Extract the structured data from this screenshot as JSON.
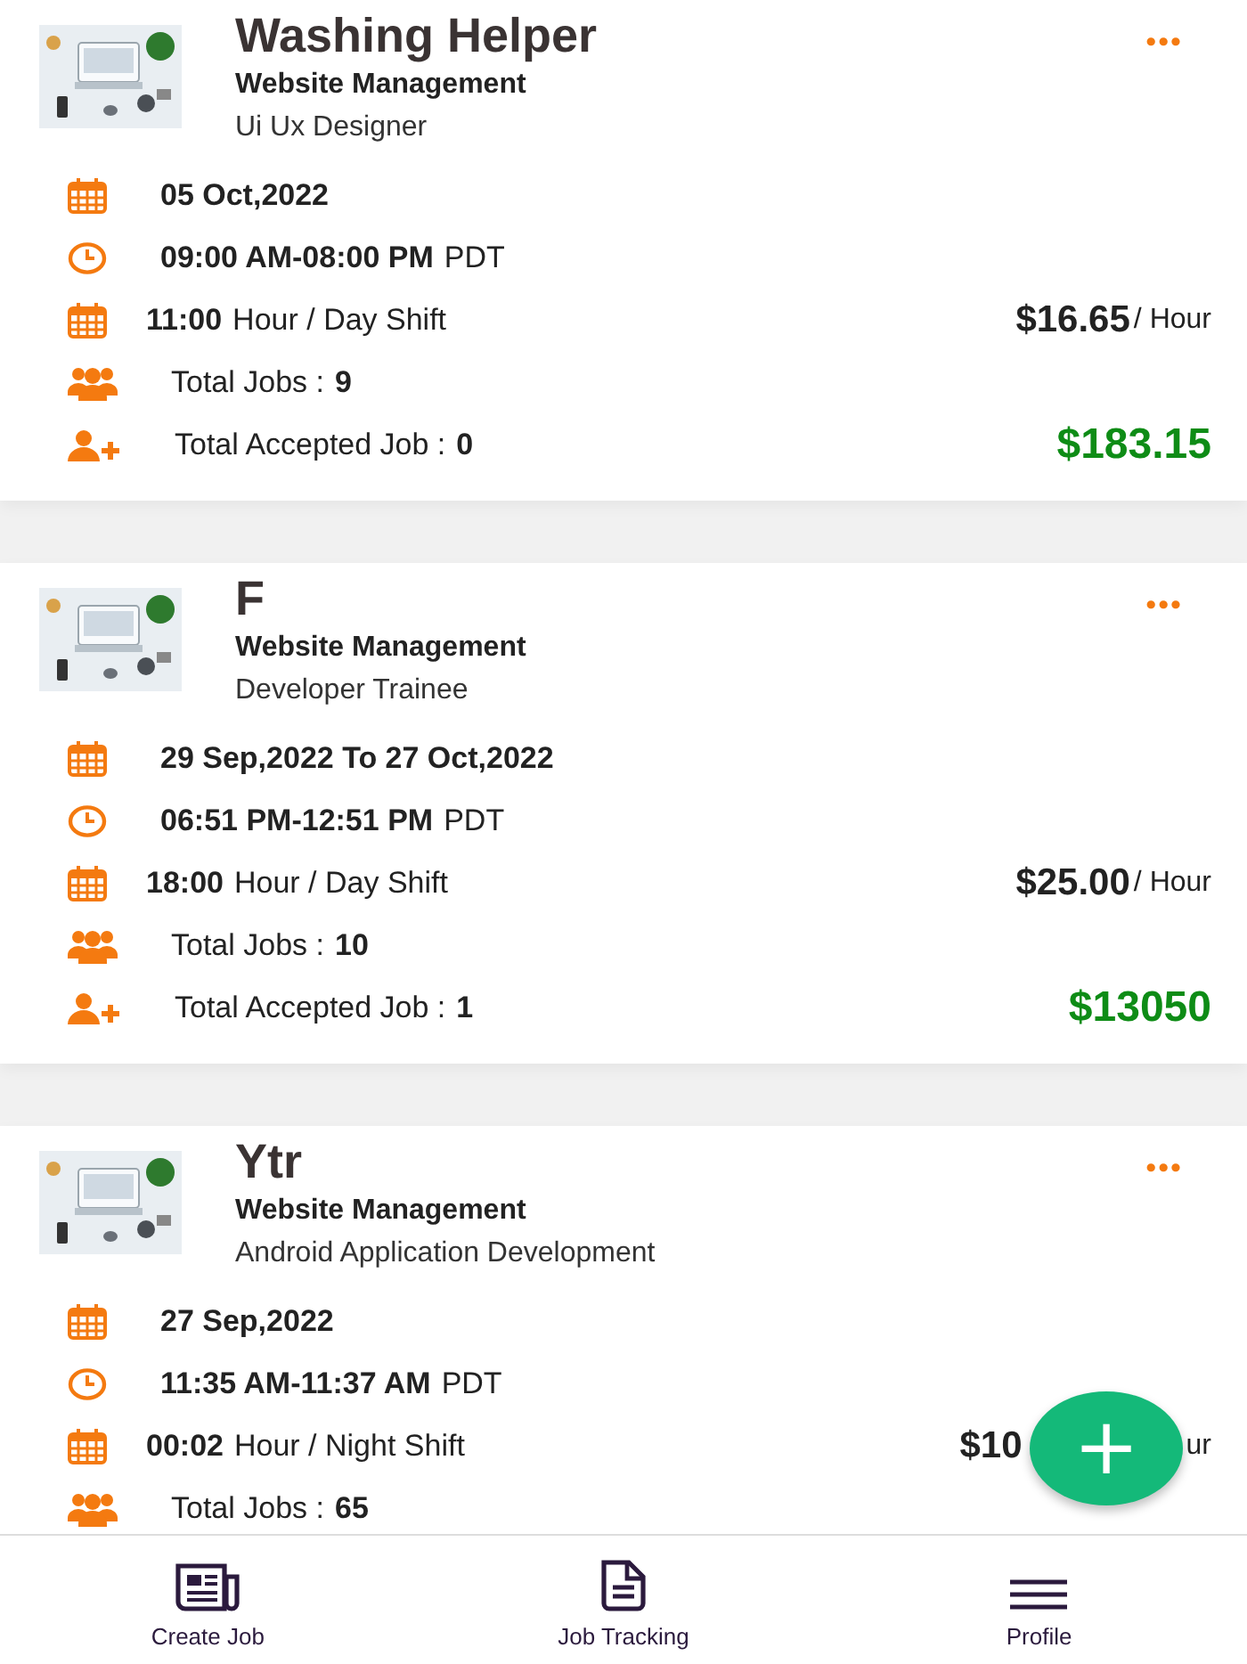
{
  "jobs": [
    {
      "title": "Washing Helper",
      "category": "Website Management",
      "role": "Ui Ux Designer",
      "date": "05 Oct,2022",
      "time": "09:00 AM-08:00 PM",
      "timezone": "PDT",
      "hours": "11:00",
      "shift": "Hour / Day Shift",
      "rate": "$16.65",
      "rate_unit": "/ Hour",
      "total_jobs_label": "Total Jobs :",
      "total_jobs": "9",
      "accepted_label": "Total Accepted Job :",
      "accepted": "0",
      "total": "$183.15",
      "menu": "•••"
    },
    {
      "title": "F",
      "category": "Website Management",
      "role": "Developer Trainee",
      "date": "29 Sep,2022 To 27 Oct,2022",
      "time": "06:51 PM-12:51 PM",
      "timezone": "PDT",
      "hours": "18:00",
      "shift": "Hour / Day Shift",
      "rate": "$25.00",
      "rate_unit": "/ Hour",
      "total_jobs_label": "Total Jobs :",
      "total_jobs": "10",
      "accepted_label": "Total Accepted Job :",
      "accepted": "1",
      "total": "$13050",
      "menu": "•••"
    },
    {
      "title": "Ytr",
      "category": "Website Management",
      "role": "Android Application Development",
      "date": "27 Sep,2022",
      "time": "11:35 AM-11:37 AM",
      "timezone": "PDT",
      "hours": "00:02",
      "shift": "Hour / Night Shift",
      "rate": "$10",
      "rate_unit": "ur",
      "rate_covered": true,
      "total_jobs_label": "Total Jobs :",
      "total_jobs": "65",
      "menu": "•••"
    }
  ],
  "fab": {
    "label": "+"
  },
  "nav": [
    {
      "label": "Create Job",
      "kind": "news"
    },
    {
      "label": "Job Tracking",
      "kind": "doc"
    },
    {
      "label": "Profile",
      "kind": "menu"
    }
  ]
}
